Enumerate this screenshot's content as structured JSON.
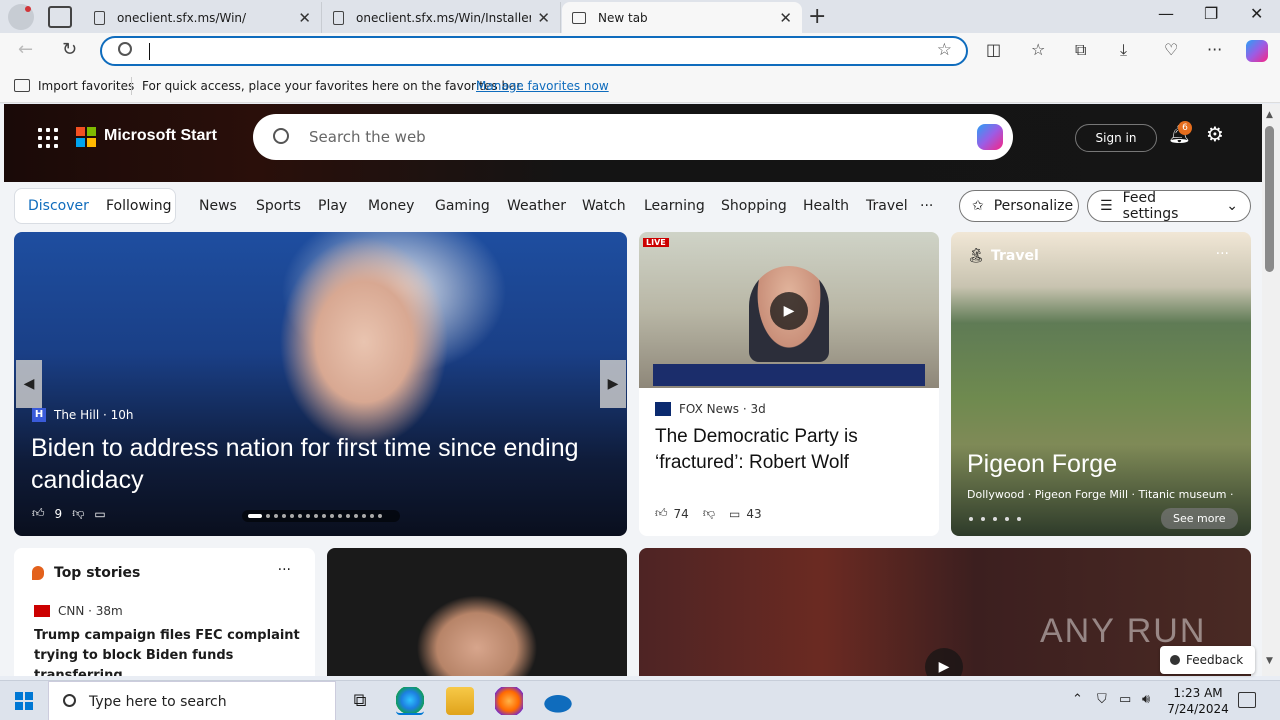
{
  "browser": {
    "tabs": [
      {
        "title": "oneclient.sfx.ms/Win/"
      },
      {
        "title": "oneclient.sfx.ms/Win/Installers/2..."
      },
      {
        "title": "New tab"
      }
    ],
    "address": {
      "value": "",
      "placeholder": ""
    },
    "favorites_bar": {
      "import_label": "Import favorites",
      "hint": "For quick access, place your favorites here on the favorites bar.",
      "manage_link": "Manage favorites now"
    }
  },
  "msstart": {
    "brand": "Microsoft Start",
    "search_placeholder": "Search the web",
    "sign_in": "Sign in",
    "notification_count": "6",
    "segments": {
      "discover": "Discover",
      "following": "Following"
    },
    "nav": [
      "News",
      "Sports",
      "Play",
      "Money",
      "Gaming",
      "Weather",
      "Watch",
      "Learning",
      "Shopping",
      "Health",
      "Travel",
      "···"
    ],
    "personalize": "Personalize",
    "feed_settings": "Feed settings"
  },
  "hero": {
    "source": "The Hill · 10h",
    "source_icon_letter": "H",
    "headline": "Biden to address nation for first time since ending candidacy",
    "likes": "9"
  },
  "fox_card": {
    "live_badge": "LIVE",
    "source": "FOX News · 3d",
    "headline": "The Democratic Party is ‘fractured’: Robert Wolf",
    "likes": "74",
    "comments": "43"
  },
  "travel_card": {
    "category": "Travel",
    "title": "Pigeon Forge",
    "subtitle": "Dollywood · Pigeon Forge Mill · Titanic museum · ...",
    "see_more": "See more"
  },
  "top_stories": {
    "heading": "Top stories",
    "source": "CNN · 38m",
    "headline": "Trump campaign files FEC complaint trying to block Biden funds transferring..."
  },
  "overlay": {
    "watermark": "ANY RUN",
    "feedback": "Feedback"
  },
  "taskbar": {
    "search_placeholder": "Type here to search",
    "time": "1:23 AM",
    "date": "7/24/2024"
  }
}
